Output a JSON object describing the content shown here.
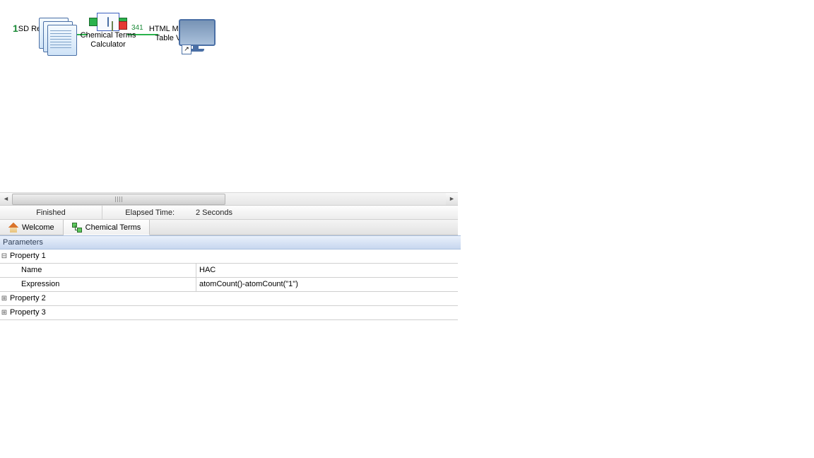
{
  "canvas": {
    "marker": "1",
    "nodes": [
      {
        "id": "sd-reader",
        "label": "SD Reader"
      },
      {
        "id": "chem-calc",
        "label": "Chemical Terms\nCalculator"
      },
      {
        "id": "html-view",
        "label": "HTML Molecular\nTable Viewer"
      }
    ],
    "wires": [
      {
        "count": "341"
      },
      {
        "count": "341"
      }
    ]
  },
  "status": {
    "state": "Finished",
    "elapsed_label": "Elapsed Time:",
    "elapsed_value": "2 Seconds"
  },
  "tabs": {
    "welcome": "Welcome",
    "chemical_terms": "Chemical Terms"
  },
  "parameters": {
    "header": "Parameters",
    "rows": [
      {
        "twisty": "⊟",
        "key": "Property 1",
        "val": "",
        "head": true
      },
      {
        "twisty": "",
        "key": "Name",
        "val": "HAC",
        "indent": true
      },
      {
        "twisty": "",
        "key": "Expression",
        "val": "atomCount()-atomCount(\"1\")",
        "indent": true
      },
      {
        "twisty": "⊞",
        "key": "Property 2",
        "val": "",
        "head": true
      },
      {
        "twisty": "⊞",
        "key": "Property 3",
        "val": "",
        "head": true
      }
    ]
  },
  "icons": {
    "arrow_shortcut": "↗"
  }
}
